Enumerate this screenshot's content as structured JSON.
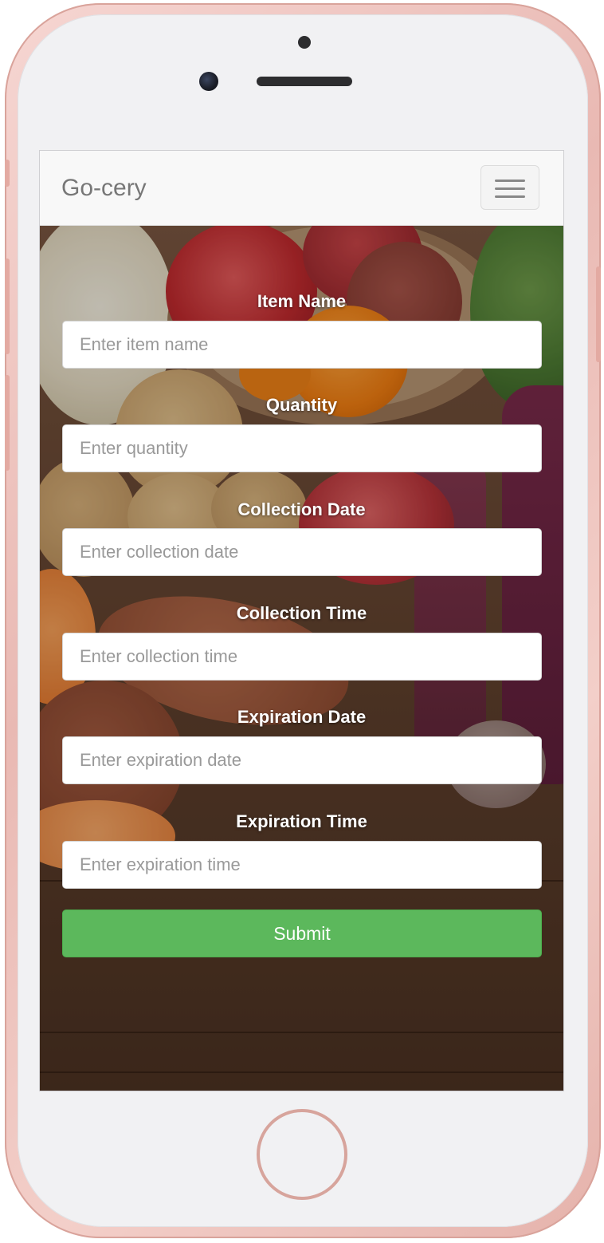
{
  "app": {
    "brand": "Go-cery",
    "menu_icon": "hamburger-menu-icon"
  },
  "form": {
    "fields": [
      {
        "label": "Item Name",
        "placeholder": "Enter item name"
      },
      {
        "label": "Quantity",
        "placeholder": "Enter quantity"
      },
      {
        "label": "Collection Date",
        "placeholder": "Enter collection date"
      },
      {
        "label": "Collection Time",
        "placeholder": "Enter collection time"
      },
      {
        "label": "Expiration Date",
        "placeholder": "Enter expiration date"
      },
      {
        "label": "Expiration Time",
        "placeholder": "Enter expiration time"
      }
    ],
    "submit_label": "Submit"
  },
  "colors": {
    "navbar_bg": "#f8f8f8",
    "brand_text": "#777777",
    "submit_green": "#5cb85c",
    "phone_frame": "#e9b9b3"
  }
}
